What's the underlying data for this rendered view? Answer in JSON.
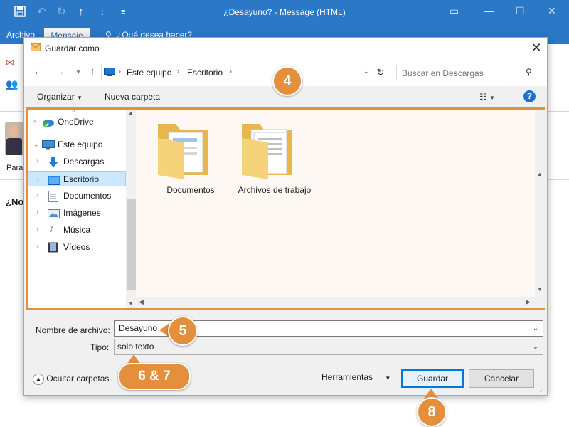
{
  "outlook": {
    "window_title": "¿Desayuno? - Message (HTML)",
    "tab_file": "Archivo",
    "tab_message": "Mensaje",
    "tell_me": "¿Qué desea hacer?",
    "to_label": "Para",
    "subject_prefix": "¿No"
  },
  "dialog": {
    "title": "Guardar como",
    "address": {
      "crumbs": [
        "Este equipo",
        "Escritorio"
      ]
    },
    "search_placeholder": "Buscar en Descargas",
    "toolbar": {
      "organize": "Organizar",
      "new_folder": "Nueva carpeta"
    },
    "nav": {
      "items": [
        {
          "label": "OneDrive",
          "icon": "onedrive-icon"
        },
        {
          "label": "Este equipo",
          "icon": "computer-icon"
        },
        {
          "label": "Descargas",
          "icon": "download-icon"
        },
        {
          "label": "Escritorio",
          "icon": "desktop-icon",
          "selected": true
        },
        {
          "label": "Documentos",
          "icon": "document-icon"
        },
        {
          "label": "Imágenes",
          "icon": "images-icon"
        },
        {
          "label": "Música",
          "icon": "music-icon"
        },
        {
          "label": "Vídeos",
          "icon": "video-icon"
        }
      ]
    },
    "files": [
      {
        "name": "Documentos",
        "icon": "folder-icon"
      },
      {
        "name": "Archivos de trabajo",
        "icon": "folder-icon"
      }
    ],
    "filename_label": "Nombre de archivo:",
    "filename_value": "Desayuno",
    "type_label": "Tipo:",
    "type_value": "solo texto",
    "hide_folders": "Ocultar carpetas",
    "tools": "Herramientas",
    "save": "Guardar",
    "cancel": "Cancelar"
  },
  "callouts": {
    "c4": "4",
    "c5": "5",
    "c67": "6 & 7",
    "c8": "8"
  },
  "colors": {
    "accent": "#e48f3c",
    "titlebar": "#2b78c6",
    "selection": "#cce8ff"
  }
}
